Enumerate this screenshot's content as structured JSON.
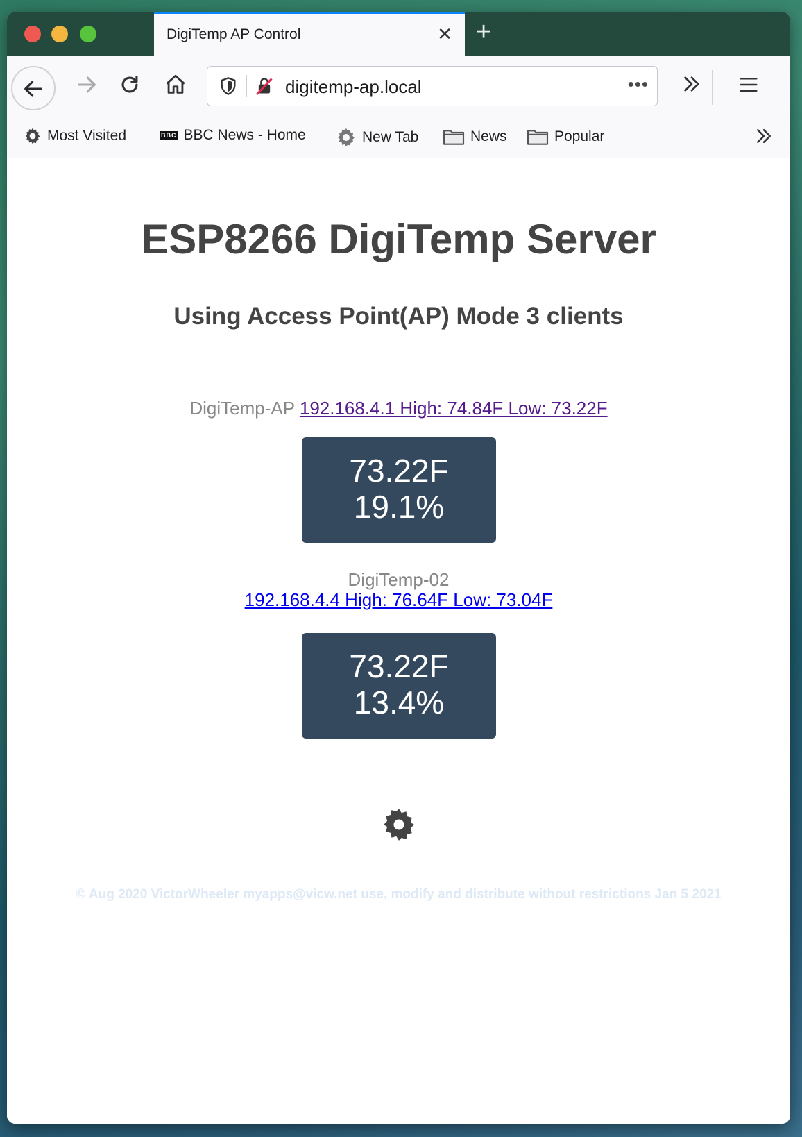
{
  "browser": {
    "tab_title": "DigiTemp AP Control",
    "tab_close": "✕",
    "new_tab": "+",
    "url": "digitemp-ap.local",
    "url_more": "•••",
    "bookmarks": [
      {
        "label": "Most Visited",
        "icon": "gear-icon"
      },
      {
        "label": "BBC News - Home",
        "icon": "bbc-icon",
        "icon_text": "BBC"
      },
      {
        "label": "New Tab",
        "icon": "gear-icon"
      },
      {
        "label": "News",
        "icon": "folder-icon"
      },
      {
        "label": "Popular",
        "icon": "folder-icon"
      }
    ]
  },
  "page": {
    "title": "ESP8266 DigiTemp Server",
    "subtitle": "Using Access Point(AP) Mode 3 clients",
    "sensors": [
      {
        "name": "DigiTemp-AP",
        "link_text": "192.168.4.1 High: 74.84F Low: 73.22F",
        "temperature": "73.22F",
        "humidity": "19.1%"
      },
      {
        "name": "DigiTemp-02",
        "link_text": "192.168.4.4 High: 76.64F Low: 73.04F",
        "temperature": "73.22F",
        "humidity": "13.4%"
      }
    ],
    "footer": "© Aug 2020 VictorWheeler myapps@vicw.net use, modify and distribute without restrictions Jan 5 2021"
  },
  "colors": {
    "card_bg": "#34495e",
    "title_text": "#444444",
    "visited_link": "#551a8b",
    "link": "#0000ee",
    "footer_text": "#dde9f5"
  }
}
